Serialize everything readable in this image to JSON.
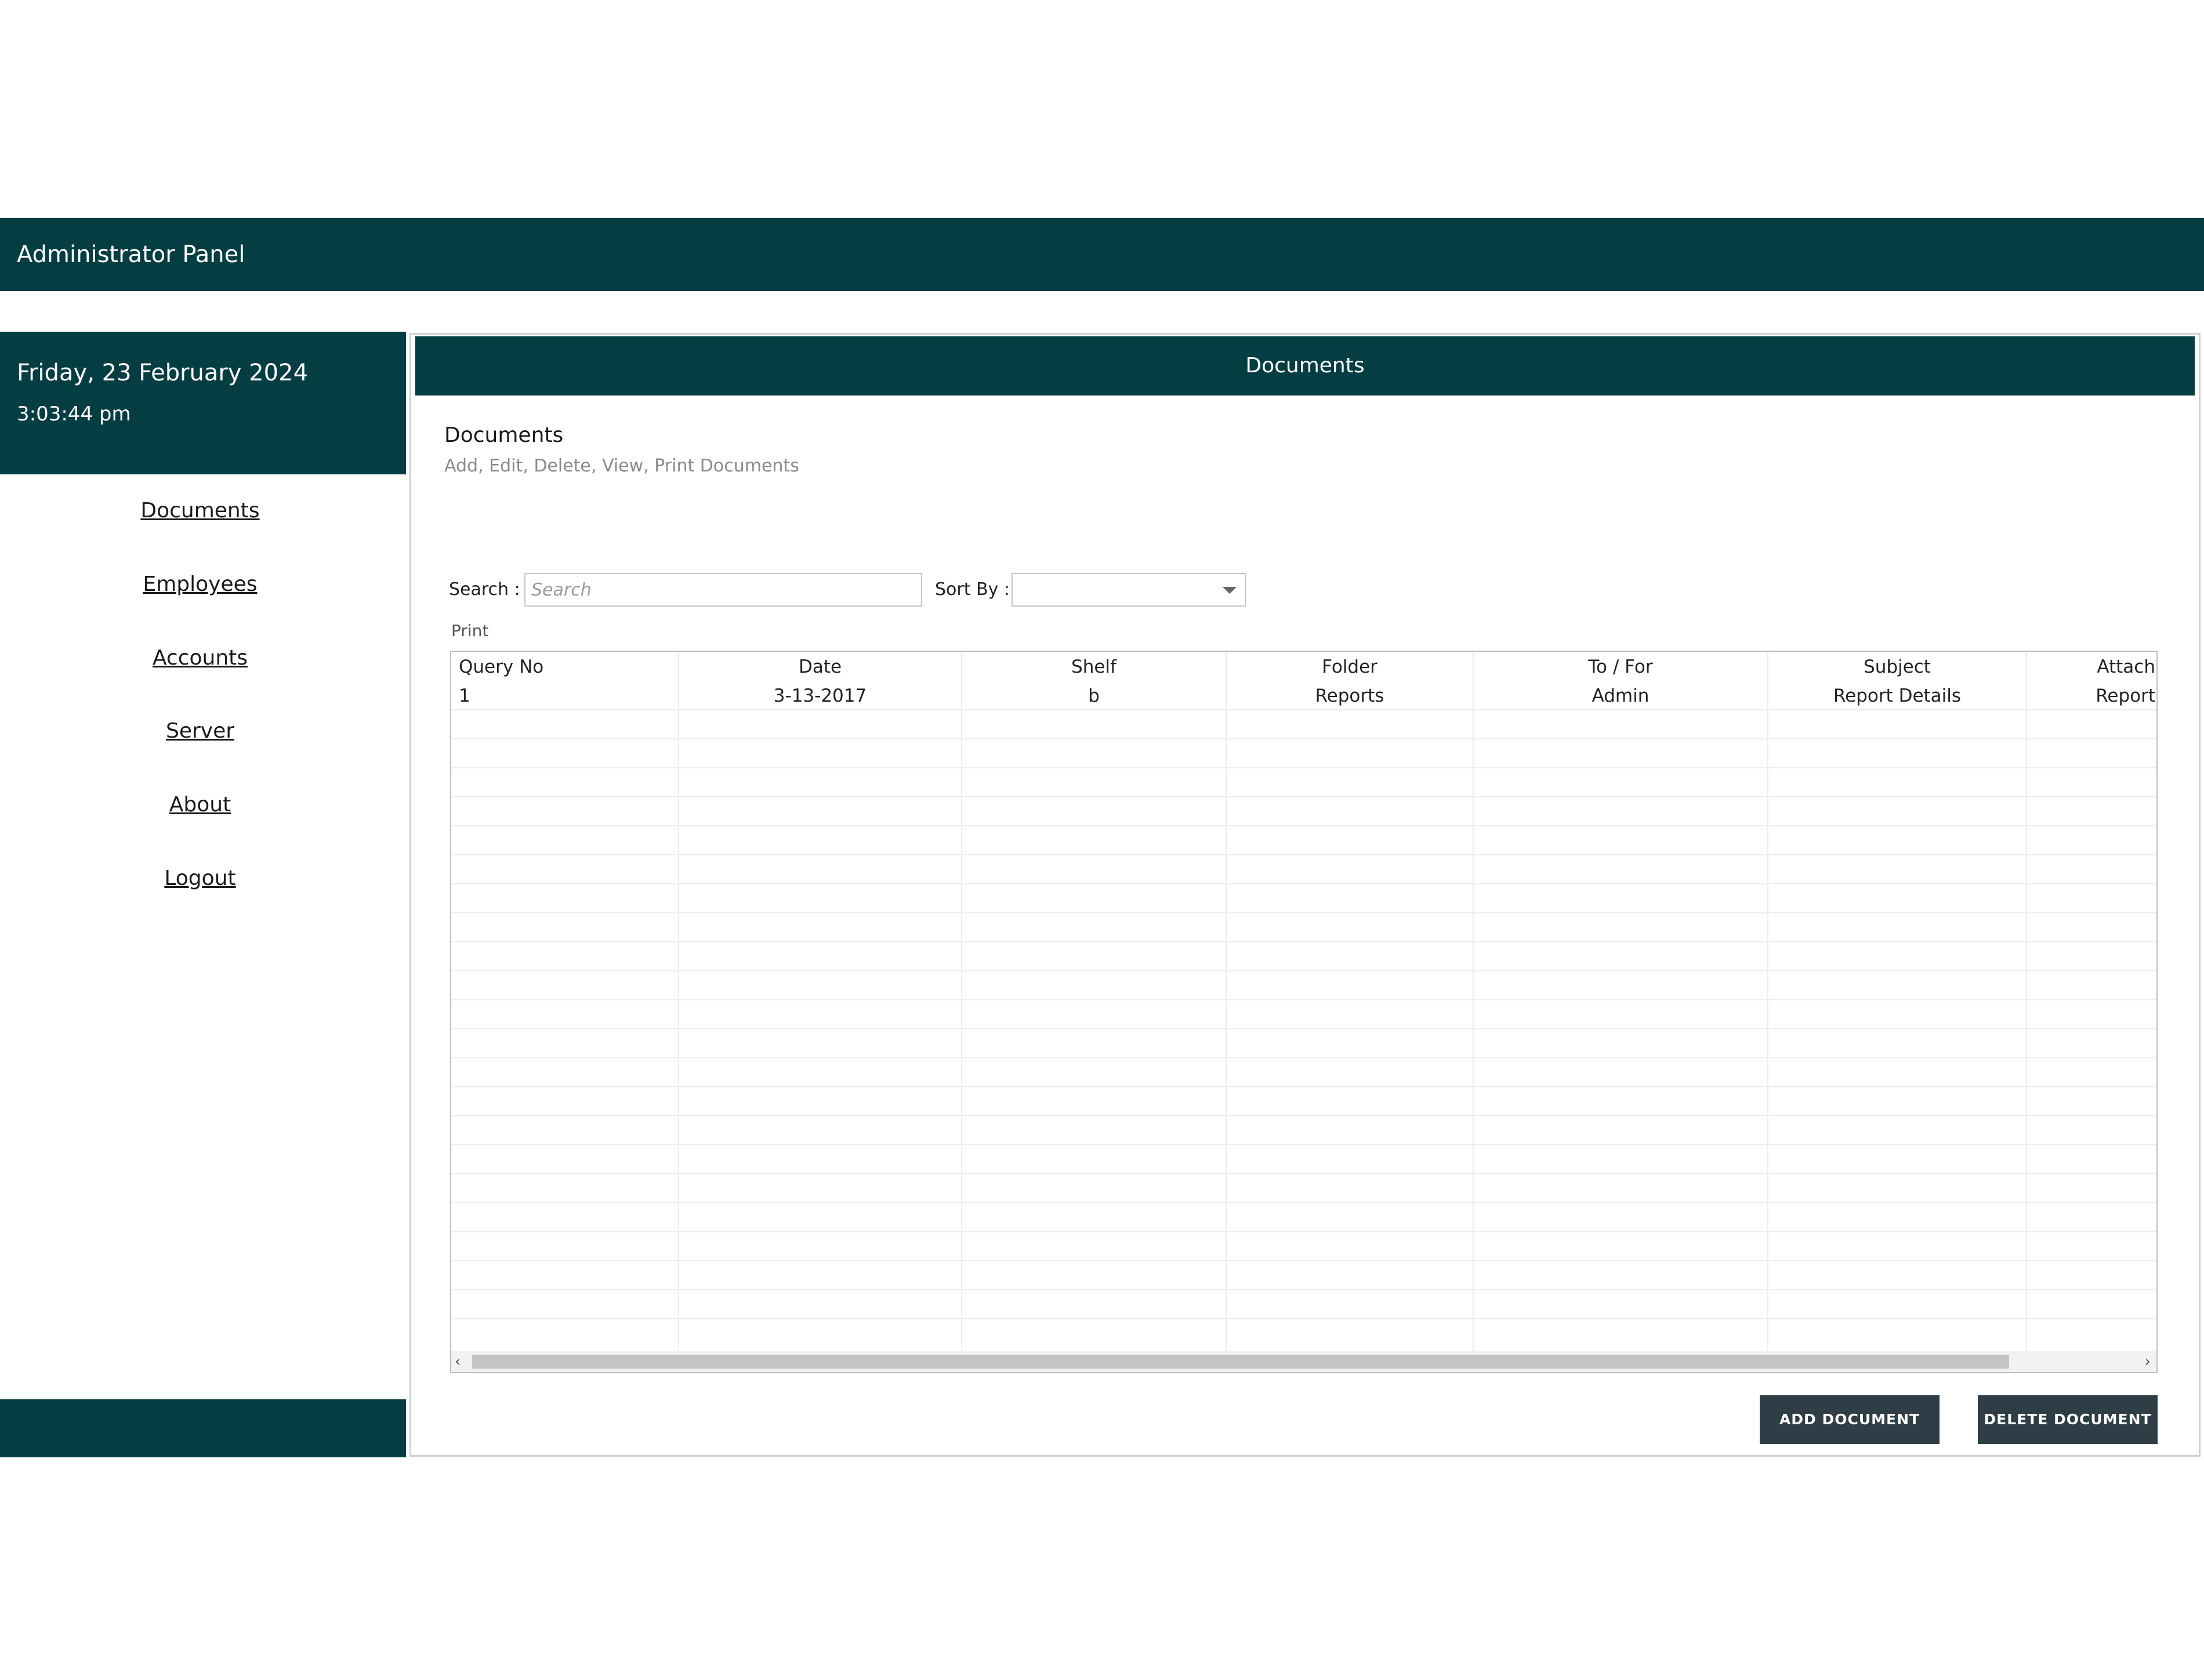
{
  "app": {
    "title": "Administrator Panel"
  },
  "sidebar": {
    "date": "Friday, 23 February 2024",
    "time": "3:03:44 pm",
    "items": [
      {
        "label": "Documents"
      },
      {
        "label": "Employees"
      },
      {
        "label": "Accounts"
      },
      {
        "label": "Server"
      },
      {
        "label": "About"
      },
      {
        "label": "Logout"
      }
    ]
  },
  "main": {
    "header": "Documents",
    "heading": "Documents",
    "subheading": "Add, Edit, Delete, View, Print Documents",
    "search": {
      "label": "Search :",
      "placeholder": "Search",
      "value": ""
    },
    "sort": {
      "label": "Sort By :",
      "value": ""
    },
    "print_label": "Print",
    "table": {
      "columns": [
        "Query No",
        "Date",
        "Shelf",
        "Folder",
        "To / For",
        "Subject",
        "Attach"
      ],
      "rows": [
        [
          "1",
          "3-13-2017",
          "b",
          "Reports",
          "Admin",
          "Report Details",
          "Report"
        ]
      ]
    },
    "buttons": {
      "add": "ADD DOCUMENT",
      "delete": "DELETE DOCUMENT"
    }
  },
  "colors": {
    "primary": "#043d42",
    "button": "#2f3e46"
  }
}
